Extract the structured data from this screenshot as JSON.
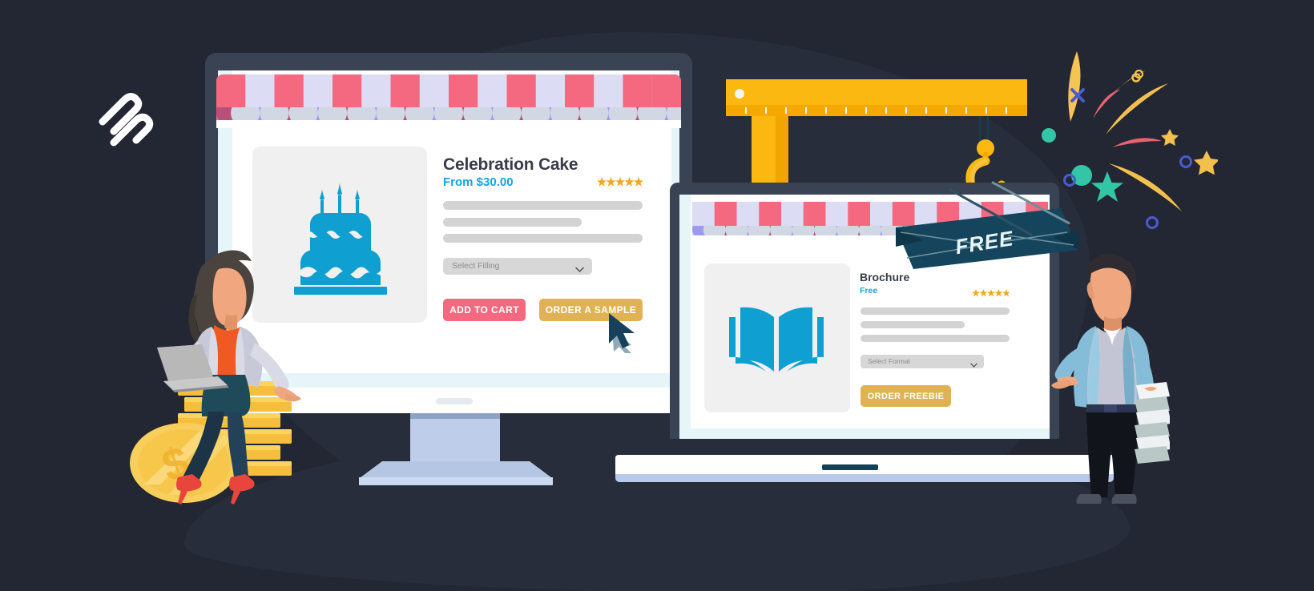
{
  "scene": {
    "background_color": "#222733",
    "blob_color": "#272d3a"
  },
  "brand": {
    "logo_name": "brand-logo-mark",
    "logo_color": "#ffffff"
  },
  "monitor": {
    "device": "desktop-monitor",
    "frame_color": "#3a4353",
    "awning": {
      "stripe_light": "#dcdcf5",
      "stripe_pink": "#f4697f",
      "scallop_purple": "#9b9cf0",
      "scallop_rose": "#b8507a"
    },
    "product": {
      "thumb_icon": "birthday-cake-icon",
      "thumb_icon_color": "#0f9fd0",
      "title": "Celebration Cake",
      "price": "From $30.00",
      "price_color": "#13a5e1",
      "rating_stars": 5,
      "rating_color": "#f5a623",
      "description_placeholder_lines": 3,
      "select": {
        "placeholder": "Select Filling",
        "value": ""
      },
      "buttons": [
        {
          "label": "ADD TO CART",
          "color": "#f4697f",
          "name": "add-to-cart-button"
        },
        {
          "label": "ORDER A SAMPLE",
          "color": "#e0b253",
          "name": "order-a-sample-button"
        }
      ]
    }
  },
  "laptop": {
    "device": "laptop",
    "frame_color": "#3a4353",
    "product": {
      "thumb_icon": "open-book-icon",
      "thumb_icon_color": "#0f9fd0",
      "title": "Brochure",
      "price": "Free",
      "price_color": "#13a5e1",
      "rating_stars": 5,
      "rating_color": "#f5a623",
      "description_placeholder_lines": 3,
      "select": {
        "placeholder": "Select Format",
        "value": ""
      },
      "buttons": [
        {
          "label": "ORDER FREEBIE",
          "color": "#e0b253",
          "name": "order-freebie-button"
        }
      ]
    }
  },
  "crane": {
    "name": "crane-ruler-arm",
    "color": "#fbb811",
    "shadow_color": "#f5a800",
    "tick_count": 14,
    "hook_color": "#fbb811",
    "rope_color": "#13414f"
  },
  "ribbon": {
    "label": "FREE",
    "fill": "#15455c",
    "fill_dark": "#0e3648",
    "text_color": "#e8f4f4"
  },
  "characters": [
    {
      "name": "woman-with-laptop-on-coins",
      "side": "left"
    },
    {
      "name": "man-presenting-with-papers",
      "side": "right"
    }
  ],
  "cursor": {
    "name": "mouse-pointer-cursor",
    "fill": "#17415b",
    "shadow": "#8fa9b8"
  },
  "confetti": {
    "colors": [
      "#f6c451",
      "#f4697f",
      "#33c6a6",
      "#4a5bd0",
      "#f5a623",
      "#e8626f"
    ]
  }
}
